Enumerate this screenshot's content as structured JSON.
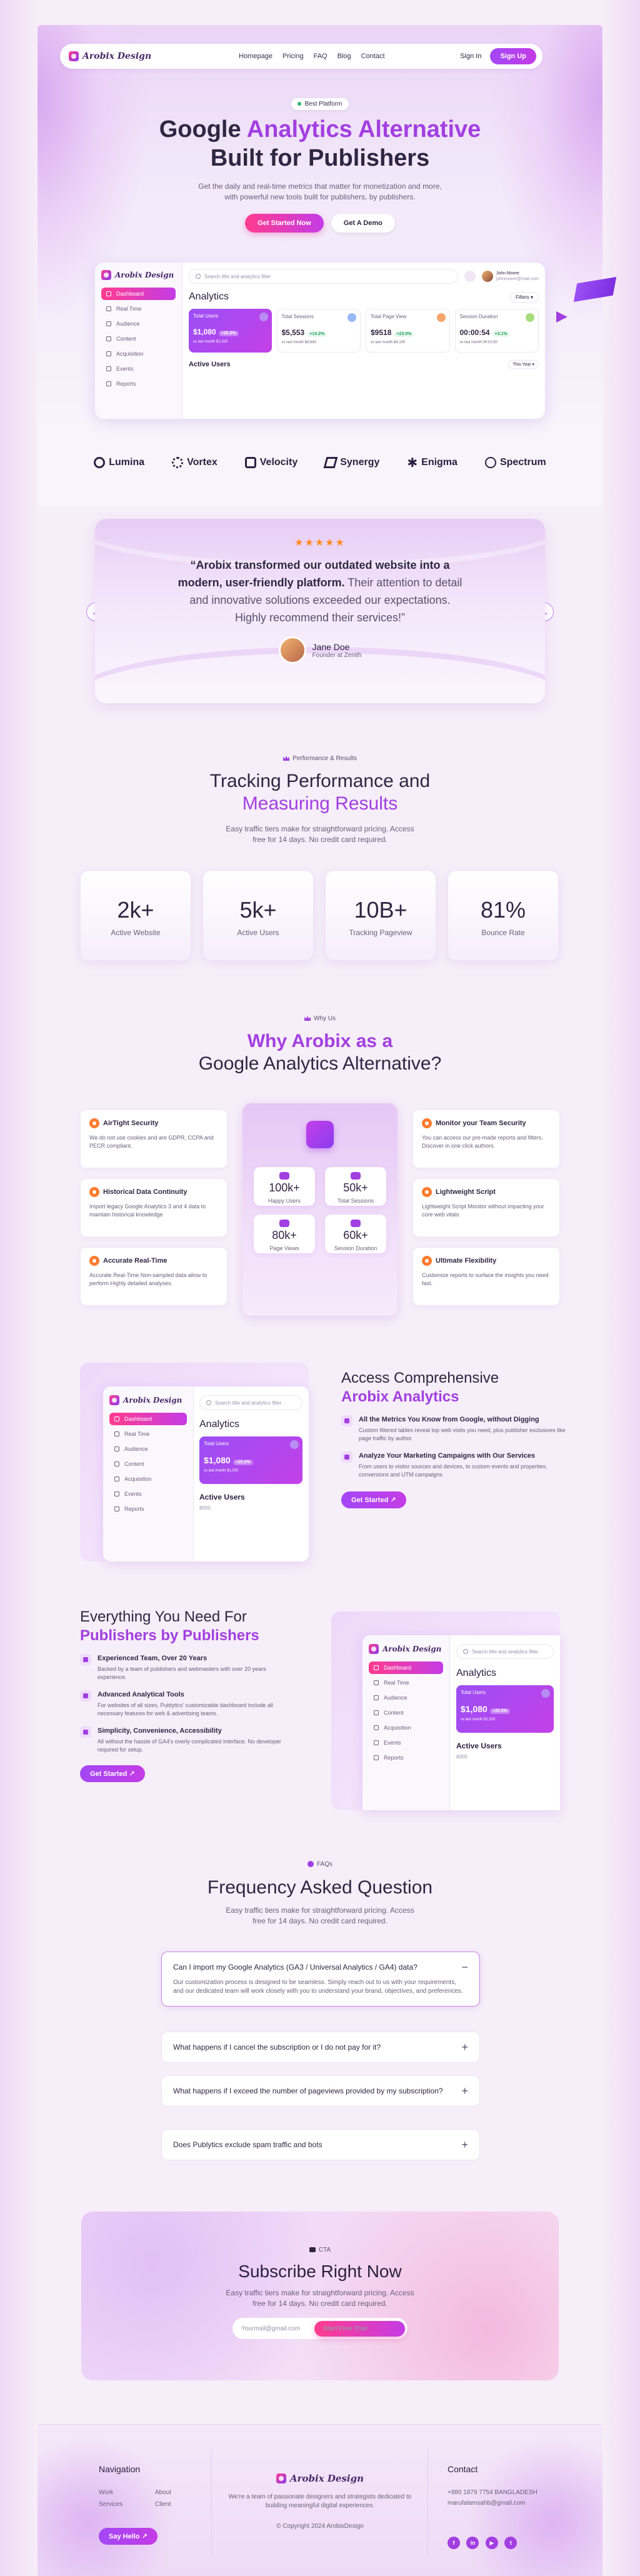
{
  "nav": {
    "logo": "Arobix Design",
    "links": [
      "Homepage",
      "Pricing",
      "FAQ",
      "Blog",
      "Contact"
    ],
    "signin": "Sign In",
    "signup": "Sign Up"
  },
  "hero": {
    "badge": "Best Platform",
    "title_line1_a": "Google ",
    "title_line1_b": "Analytics Alternative",
    "title_line2": "Built for Publishers",
    "subtitle_1": "Get the daily and real-time metrics that matter for monetization and more,",
    "subtitle_2": "with powerful new tools built for publishers, by publishers.",
    "cta_primary": "Get Started Now",
    "cta_secondary": "Get A Demo"
  },
  "dashboard": {
    "logo": "Arobix Design",
    "search_placeholder": "Search title and analytics filter",
    "user_name": "John Moore",
    "user_email": "johnmoore@mail.com",
    "title": "Analytics",
    "filter": "Filters",
    "sidebar": [
      "Dashboard",
      "Real Time",
      "Audience",
      "Content",
      "Acquisition",
      "Events",
      "Reports"
    ],
    "cards": [
      {
        "label": "Total Users",
        "value": "$1,080",
        "pct": "+20.0%",
        "note": "vs last month $1,020"
      },
      {
        "label": "Total Sessions",
        "value": "$5,553",
        "pct": "+14.2%",
        "note": "vs last month $4,840"
      },
      {
        "label": "Total Page View",
        "value": "$9518",
        "pct": "+23.0%",
        "note": "vs last month $4,100"
      },
      {
        "label": "Session Duration",
        "value": "00:00:54",
        "pct": "+3.1%",
        "note": "vs last month 00:02:50"
      }
    ],
    "active_users": "Active Users",
    "period": "This Year"
  },
  "logos": [
    "Lumina",
    "Vortex",
    "Velocity",
    "Synergy",
    "Enigma",
    "Spectrum"
  ],
  "testimonial": {
    "stars": "★★★★★",
    "quote_bold_1": "“Arobix transformed our outdated website into a",
    "quote_bold_2": "modern, user-friendly platform.",
    "quote_light_2": " Their attention to detail",
    "quote_light_3": "and innovative solutions exceeded our expectations.",
    "quote_light_4": "Highly recommend their services!”",
    "name": "Jane Doe",
    "role": "Founder at Zenith"
  },
  "performance": {
    "badge": "Performance & Results",
    "title_1": "Tracking Performance and",
    "title_2": "Measuring Results",
    "sub_1": "Easy traffic tiers make for straightforward pricing. Access",
    "sub_2": "free for 14 days. No credit card required.",
    "stats": [
      {
        "num": "2k+",
        "label": "Active Website"
      },
      {
        "num": "5k+",
        "label": "Active Users"
      },
      {
        "num": "10B+",
        "label": "Tracking Pageview"
      },
      {
        "num": "81%",
        "label": "Bounce Rate"
      }
    ]
  },
  "why": {
    "badge": "Why Us",
    "title_1": "Why Arobix as a",
    "title_2": "Google Analytics Alternative?",
    "left": [
      {
        "title": "AirTight Security",
        "desc": "We do not use cookies and are GDPR, CCPA and PECR compliant."
      },
      {
        "title": "Historical Data Continuity",
        "desc": "Import legacy Google Analytics 3 and 4 data to maintain historical knowledge"
      },
      {
        "title": "Accurate Real-Time",
        "desc": "Accurate Real-Time Non-sampled data allow to perform Highly detailed analyses."
      }
    ],
    "right": [
      {
        "title": "Monitor your Team Security",
        "desc": "You can access our pre-made reports and filters. Discover in one click authors."
      },
      {
        "title": "Lightweight Script",
        "desc": "Lightweight Script Monitor without impacting your core web vitals"
      },
      {
        "title": "Ultimate Flexibility",
        "desc": "Customize reports to surface the insights you need fast."
      }
    ],
    "mini": [
      {
        "num": "100k+",
        "label": "Happy Users"
      },
      {
        "num": "50k+",
        "label": "Total Sessions"
      },
      {
        "num": "80k+",
        "label": "Page Views"
      },
      {
        "num": "60k+",
        "label": "Session Duration"
      }
    ]
  },
  "access": {
    "title_1": "Access Comprehensive",
    "title_2": "Arobix Analytics",
    "bullets": [
      {
        "title": "All the Metrics You Know from Google, without Digging",
        "desc": "Custom filtered tables reveal top web visits you need, plus publisher exclusives like page traffic by author."
      },
      {
        "title": "Analyze Your Marketing Campaigns with Our Services",
        "desc": "From users to visitor sources and devices, to custom events and properties, conversions and UTM campaigns."
      }
    ],
    "cta": "Get Started",
    "panel_title": "Analytics",
    "panel_card_label": "Total Users",
    "panel_card_value": "$1,080",
    "panel_card_pct": "+20.0%",
    "panel_card_note": "vs last month $1,020",
    "panel_active": "Active Users",
    "panel_count": "8000"
  },
  "everything": {
    "title_1": "Everything You Need For",
    "title_2": "Publishers by Publishers",
    "bullets": [
      {
        "title": "Experienced Team, Over 20 Years",
        "desc": "Backed by a team of publishers and webmasters with over 20 years experience."
      },
      {
        "title": "Advanced Analytical Tools",
        "desc": "For websites of all sizes, Publytics' customizable dashboard include all necessary features for web & advertising teams."
      },
      {
        "title": "Simplicity, Convenience, Accessibility",
        "desc": "All without the hassle of GA4's overly complicated interface. No developer required for setup."
      }
    ],
    "cta": "Get Started"
  },
  "faq": {
    "badge": "FAQs",
    "title": "Frequency Asked Question",
    "sub_1": "Easy traffic tiers make for straightforward pricing. Access",
    "sub_2": "free for 14 days. No credit card required.",
    "items": [
      {
        "q": "Can I import my Google Analytics (GA3 / Universal Analytics / GA4) data?",
        "a": "Our customization process is designed to be seamless. Simply reach out to us with your requirements, and our dedicated team will work closely with you to understand your brand, objectives, and preferences.",
        "sign": "−"
      },
      {
        "q": "What happens if I cancel the subscription or I do not pay for it?",
        "sign": "+"
      },
      {
        "q": "What happens if I exceed the number of pageviews provided by my subscription?",
        "sign": "+"
      },
      {
        "q": "Does Publytics exclude spam traffic and bots",
        "sign": "+"
      }
    ]
  },
  "subscribe": {
    "badge": "CTA",
    "title": "Subscribe Right Now",
    "sub_1": "Easy traffic tiers make for straightforward pricing. Access",
    "sub_2": "free for 14 days. No credit card required.",
    "placeholder": "Yourmail@gmail.com",
    "cta": "Start Free Trial"
  },
  "footer": {
    "nav_title": "Navigation",
    "links": [
      "Work",
      "About",
      "Services",
      "Client"
    ],
    "say_hello": "Say Hello",
    "logo": "Arobix Design",
    "desc_1": "We're a team of passionate designers and strategists dedicated to",
    "desc_2": "building meaningful digital experiences.",
    "copyright": "© Copyright 2024 ArobixDesign",
    "contact_title": "Contact",
    "phone": "+880 1879 7754 BANGLADESH",
    "email": "marufalamsahb@gmail.com",
    "social": [
      "f",
      "in",
      "▶",
      "t"
    ]
  },
  "colors": {
    "accent": "#a23fe0",
    "pink": "#ff3c8e",
    "star": "#ff8a1e"
  }
}
